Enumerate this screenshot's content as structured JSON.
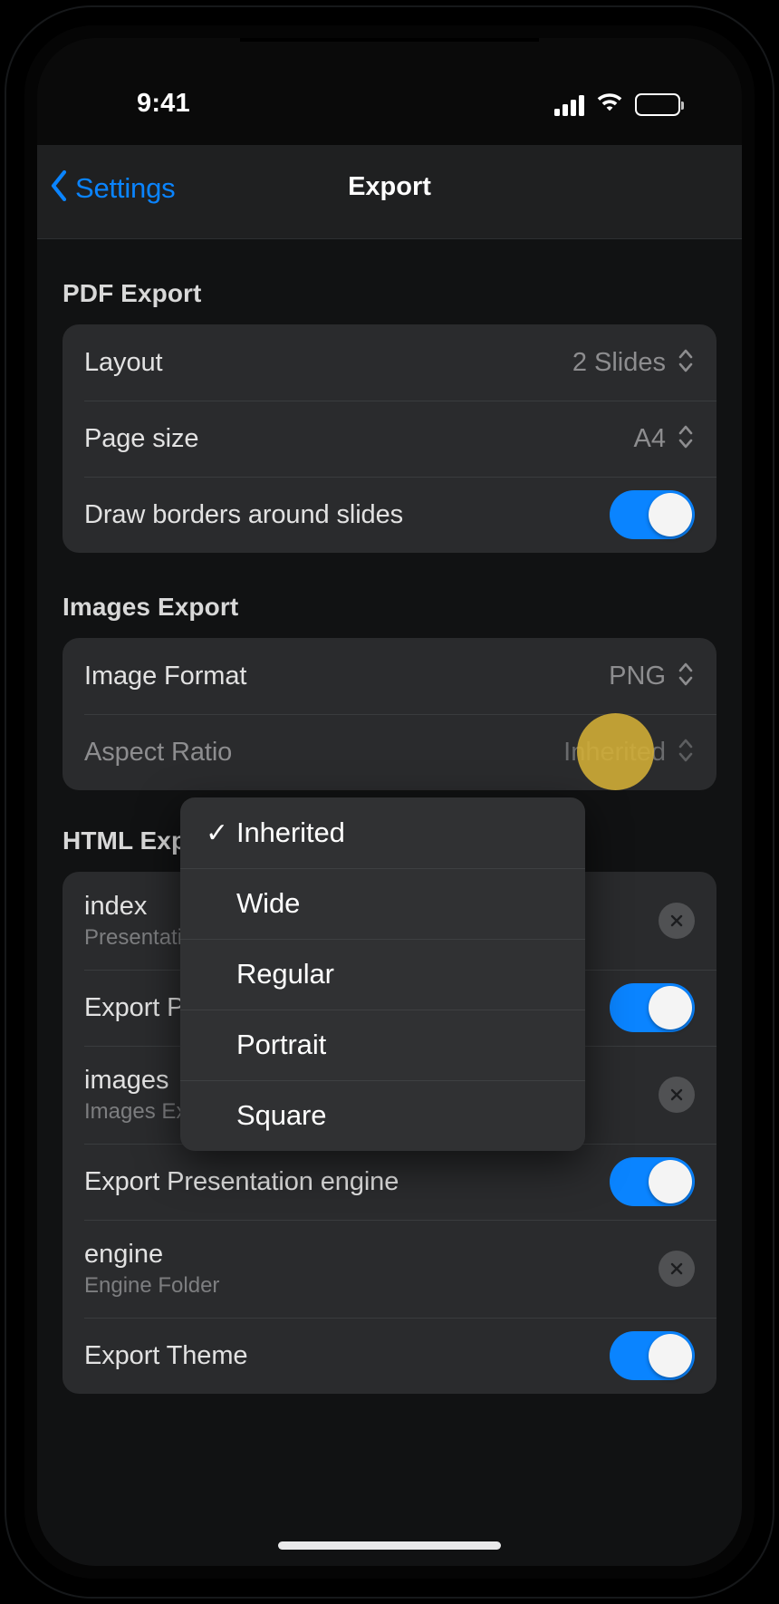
{
  "status_bar": {
    "time": "9:41",
    "cellular_icon": "cellular-bars-icon",
    "wifi_icon": "wifi-icon",
    "battery_icon": "battery-full-icon"
  },
  "nav_bar": {
    "back_label": "Settings",
    "back_icon": "chevron-left-icon",
    "title": "Export"
  },
  "sections": [
    {
      "header": "PDF Export",
      "rows": [
        {
          "label": "Layout",
          "value": "2 Slides",
          "control": "stepper"
        },
        {
          "label": "Page size",
          "value": "A4",
          "control": "stepper"
        },
        {
          "label": "Draw borders around slides",
          "control": "toggle",
          "toggle_on": true
        }
      ]
    },
    {
      "header": "Images Export",
      "rows": [
        {
          "label": "Image Format",
          "value": "PNG",
          "control": "stepper"
        },
        {
          "label": "Aspect Ratio",
          "value": "Inherited",
          "control": "stepper",
          "dimmed": true
        }
      ]
    },
    {
      "header": "HTML Export",
      "rows": [
        {
          "label": "index",
          "sublabel": "Presentation File",
          "control": "clear"
        },
        {
          "label": "Export Presentation",
          "control": "toggle",
          "toggle_on": true
        },
        {
          "label": "images",
          "sublabel": "Images Export Folder",
          "control": "clear"
        },
        {
          "label": "Export Presentation engine",
          "control": "toggle",
          "toggle_on": true
        },
        {
          "label": "engine",
          "sublabel": "Engine Folder",
          "control": "clear"
        },
        {
          "label": "Export Theme",
          "control": "toggle",
          "toggle_on": true
        }
      ]
    }
  ],
  "dropdown": {
    "title": "Aspect Ratio",
    "selected": "Inherited",
    "check_glyph": "✓",
    "items": [
      {
        "label": "Inherited",
        "checked": true
      },
      {
        "label": "Wide",
        "checked": false
      },
      {
        "label": "Regular",
        "checked": false
      },
      {
        "label": "Portrait",
        "checked": false
      },
      {
        "label": "Square",
        "checked": false
      }
    ]
  },
  "tap_indicator": {
    "name": "tap-highlight",
    "color": "#d4af37"
  },
  "colors": {
    "accent_blue": "#0a84ff",
    "toggle_on": "#0a84ff",
    "background": "#111213",
    "group_background": "#2a2b2d",
    "menu_background": "#303133"
  }
}
